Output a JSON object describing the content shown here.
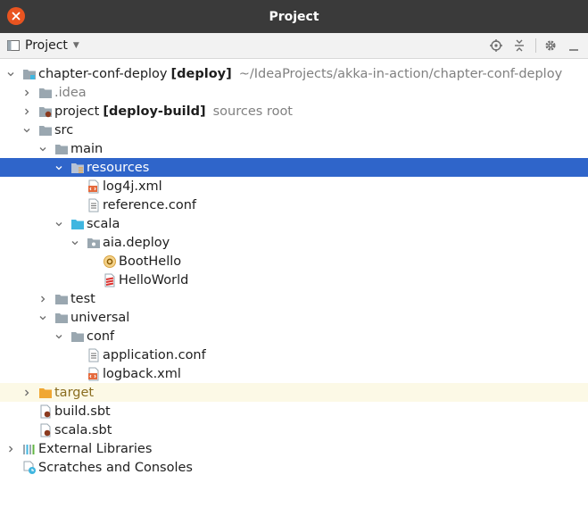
{
  "window": {
    "title": "Project"
  },
  "toolbar": {
    "view_label": "Project"
  },
  "tree": {
    "root": {
      "name": "chapter-conf-deploy",
      "module": "[deploy]",
      "path": "~/IdeaProjects/akka-in-action/chapter-conf-deploy"
    },
    "idea": ".idea",
    "project": {
      "name": "project",
      "module": "[deploy-build]",
      "hint": "sources root"
    },
    "src": "src",
    "main": "main",
    "resources": "resources",
    "log4j": "log4j.xml",
    "reference_conf": "reference.conf",
    "scala": "scala",
    "aia_deploy": "aia.deploy",
    "boot_hello": "BootHello",
    "hello_world": "HelloWorld",
    "test": "test",
    "universal": "universal",
    "conf": "conf",
    "application_conf": "application.conf",
    "logback": "logback.xml",
    "target": "target",
    "build_sbt": "build.sbt",
    "scala_sbt": "scala.sbt",
    "external_libraries": "External Libraries",
    "scratches": "Scratches and Consoles"
  }
}
